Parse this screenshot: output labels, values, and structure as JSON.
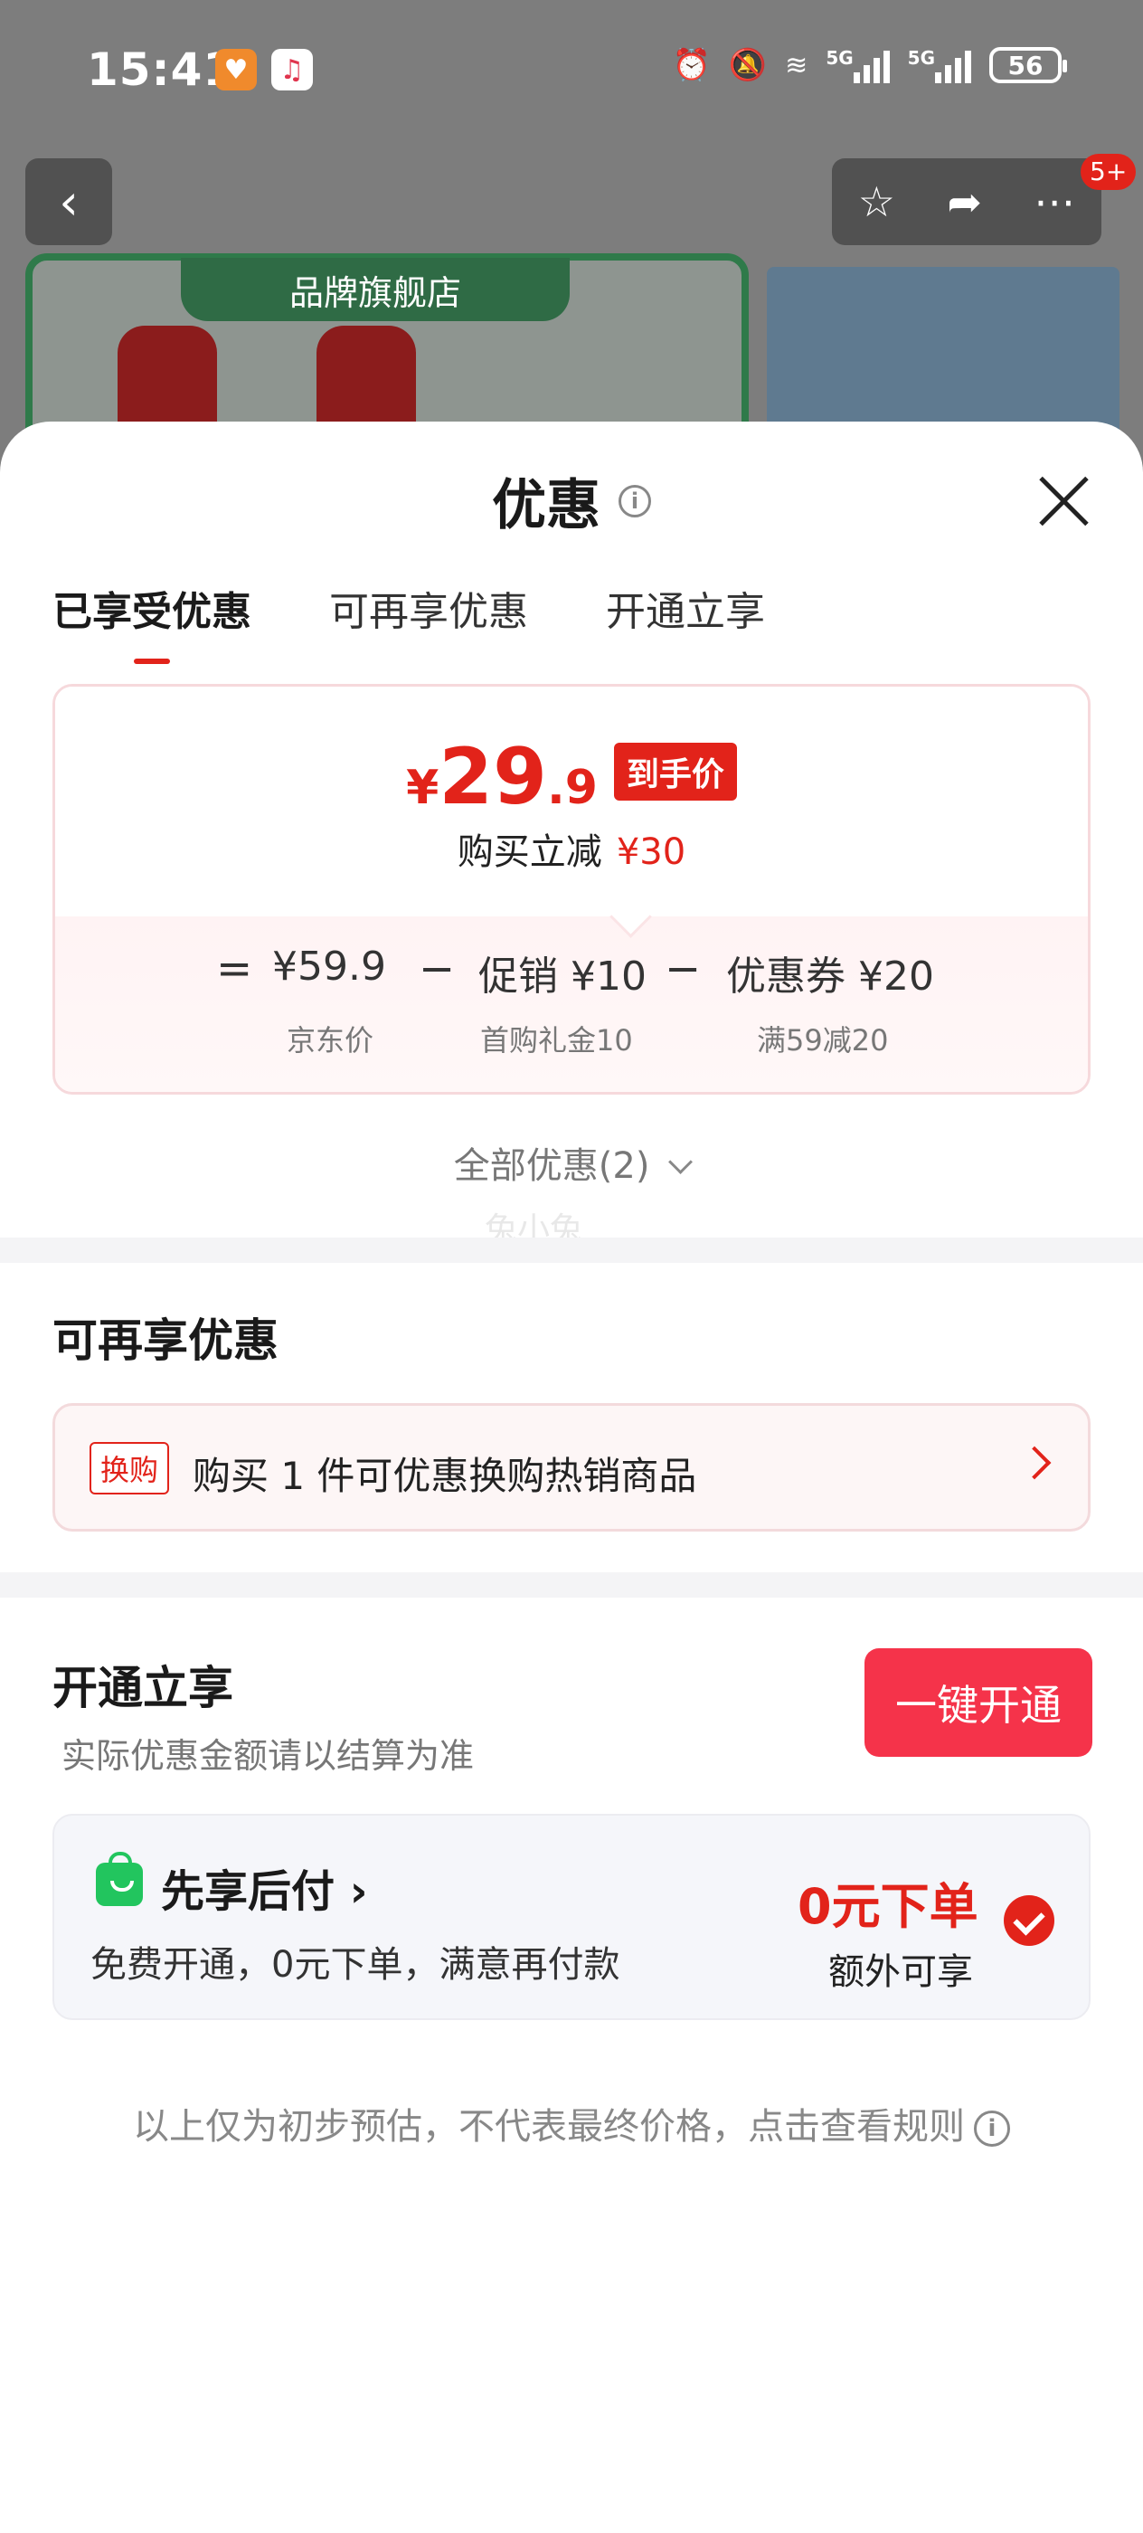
{
  "status_bar": {
    "time": "15:41",
    "signal1_tag": "5G",
    "signal2_tag": "5G",
    "battery": "56"
  },
  "background": {
    "brand_label": "品牌旗舰店",
    "cart_badge": "5+"
  },
  "sheet": {
    "title": "优惠",
    "tabs": [
      "已享受优惠",
      "可再享优惠",
      "开通立享"
    ],
    "active_tab": 0
  },
  "price_card": {
    "currency": "¥",
    "final_int": "29",
    "final_dec": ".9",
    "final_tag": "到手价",
    "reduce_label": "购买立减",
    "reduce_value": "¥30",
    "equation": {
      "eq": "=",
      "jd_price": "¥59.9",
      "jd_price_label": "京东价",
      "minus1": "−",
      "promo": "促销 ¥10",
      "promo_label": "首购礼金10",
      "minus2": "−",
      "coupon": "优惠券 ¥20",
      "coupon_label": "满59减20"
    }
  },
  "all_offers": "全部优惠(2)",
  "watermark": "兔小兔",
  "more_offers": {
    "title": "可再享优惠",
    "swap_tag": "换购",
    "swap_text": "购买 1 件可优惠换购热销商品"
  },
  "open_section": {
    "title": "开通立享",
    "subtitle": "实际优惠金额请以结算为准",
    "button": "一键开通",
    "pay_title": "先享后付",
    "pay_desc": "免费开通，0元下单，满意再付款",
    "pay_highlight": "0元下单",
    "pay_extra": "额外可享",
    "checked": true
  },
  "footer": {
    "note": "以上仅为初步预估，不代表最终价格，点击查看规则"
  },
  "colors": {
    "accent": "#e2231a",
    "button": "#f5334a"
  }
}
